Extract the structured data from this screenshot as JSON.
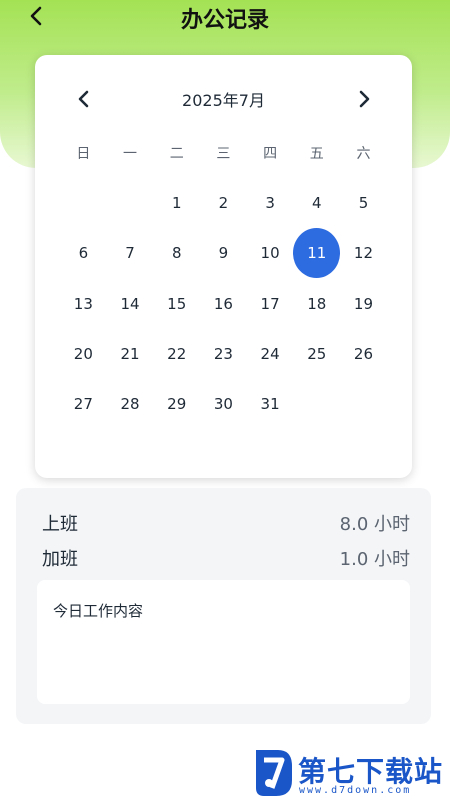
{
  "header": {
    "title": "办公记录",
    "back_icon": "chevron-left-icon"
  },
  "calendar": {
    "month_title": "2025年7月",
    "prev_icon": "chevron-left-icon",
    "next_icon": "chevron-right-icon",
    "weekdays": [
      "日",
      "一",
      "二",
      "三",
      "四",
      "五",
      "六"
    ],
    "days": [
      "",
      "",
      "1",
      "2",
      "3",
      "4",
      "5",
      "6",
      "7",
      "8",
      "9",
      "10",
      "11",
      "12",
      "13",
      "14",
      "15",
      "16",
      "17",
      "18",
      "19",
      "20",
      "21",
      "22",
      "23",
      "24",
      "25",
      "26",
      "27",
      "28",
      "29",
      "30",
      "31",
      "",
      ""
    ],
    "selected_day": "11",
    "accent_color": "#2d6be0"
  },
  "summary": {
    "work_label": "上班",
    "work_value": "8.0 小时",
    "overtime_label": "加班",
    "overtime_value": "1.0 小时",
    "content_placeholder": "今日工作内容"
  },
  "watermark": {
    "name": "第七下载站",
    "url": "www.d7down.com"
  },
  "colors": {
    "header_gradient_top": "#a4e254",
    "panel_background": "#f3f5f7",
    "watermark_blue": "#1a56c8"
  }
}
